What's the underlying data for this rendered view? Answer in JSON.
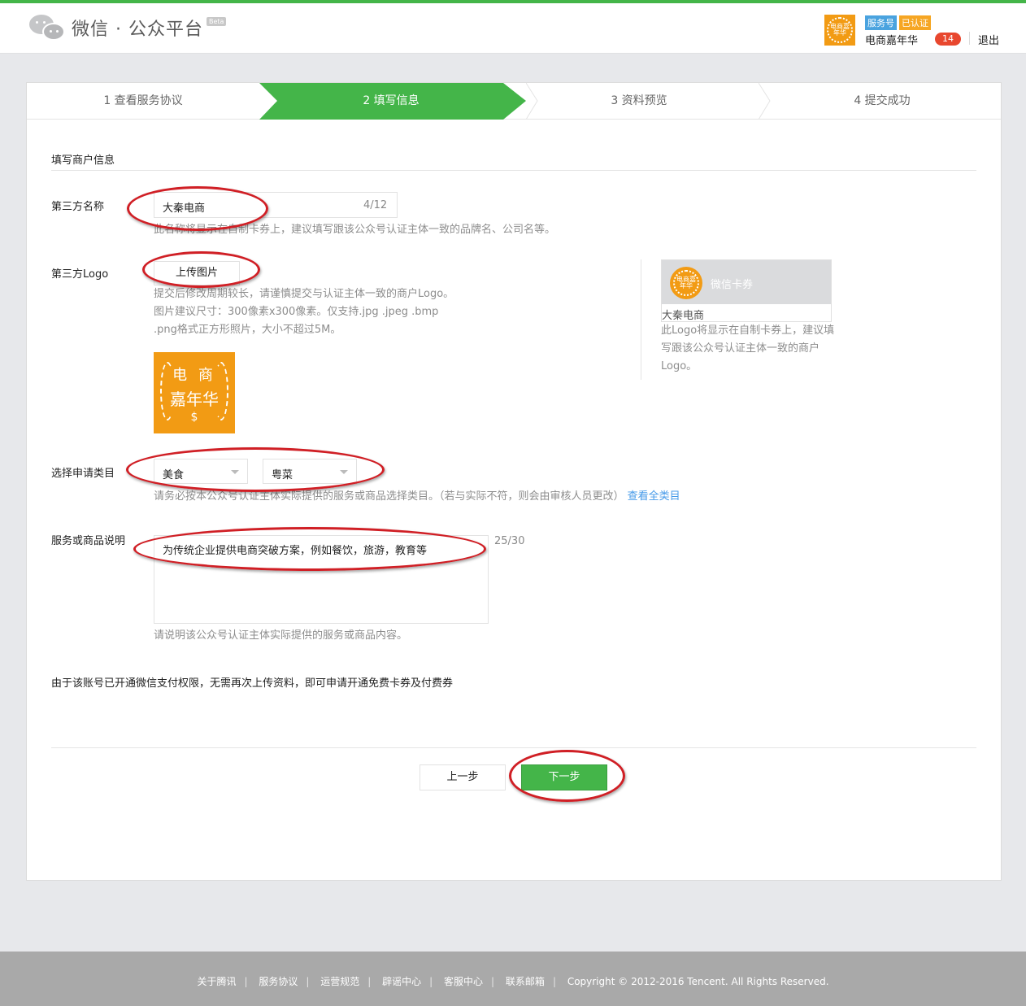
{
  "header": {
    "logo_text": "微信 · 公众平台",
    "beta": "Beta",
    "account_badge_type": "服务号",
    "account_badge_verified": "已认证",
    "account_name": "电商嘉年华",
    "message_count": "14",
    "logout": "退出",
    "avatar_text": "电商嘉年华"
  },
  "steps": [
    {
      "label": "1 查看服务协议"
    },
    {
      "label": "2 填写信息"
    },
    {
      "label": "3 资料预览"
    },
    {
      "label": "4 提交成功"
    }
  ],
  "form": {
    "section_title": "填写商户信息",
    "name_label": "第三方名称",
    "name_value": "大秦电商",
    "name_counter": "4/12",
    "name_hint": "此名称将显示在自制卡券上，建议填写跟该公众号认证主体一致的品牌名、公司名等。",
    "logo_label": "第三方Logo",
    "upload_button": "上传图片",
    "logo_hint_1": "提交后修改周期较长，请谨慎提交与认证主体一致的商户Logo。",
    "logo_hint_2": "图片建议尺寸：300像素x300像素。仅支持.jpg .jpeg .bmp",
    "logo_hint_3": ".png格式正方形照片，大小不超过5M。",
    "logo_image_line1": "电 商",
    "logo_image_line2": "嘉年华",
    "logo_image_line3": "$",
    "category_label": "选择申请类目",
    "category_primary": "美食",
    "category_secondary": "粤菜",
    "category_hint": "请务必按本公众号认证主体实际提供的服务或商品选择类目。（若与实际不符，则会由审核人员更改）",
    "category_link": "查看全类目",
    "desc_label": "服务或商品说明",
    "desc_value": "为传统企业提供电商突破方案，例如餐饮，旅游，教育等",
    "desc_counter": "25/30",
    "desc_hint": "请说明该公众号认证主体实际提供的服务或商品内容。",
    "notice": "由于该账号已开通微信支付权限，无需再次上传资料，即可申请开通免费卡券及付费券",
    "prev_button": "上一步",
    "next_button": "下一步"
  },
  "preview": {
    "card_title": "微信卡券",
    "merchant_name": "大秦电商",
    "desc": "此Logo将显示在自制卡券上，建议填写跟该公众号认证主体一致的商户Logo。"
  },
  "footer": {
    "links": [
      "关于腾讯",
      "服务协议",
      "运营规范",
      "辟谣中心",
      "客服中心",
      "联系邮箱"
    ],
    "copyright": "Copyright © 2012-2016 Tencent. All Rights Reserved."
  },
  "colors": {
    "accent_green": "#44b549",
    "annotation_red": "#d01f25",
    "logo_orange": "#f29b14",
    "link_blue": "#459ae9"
  }
}
